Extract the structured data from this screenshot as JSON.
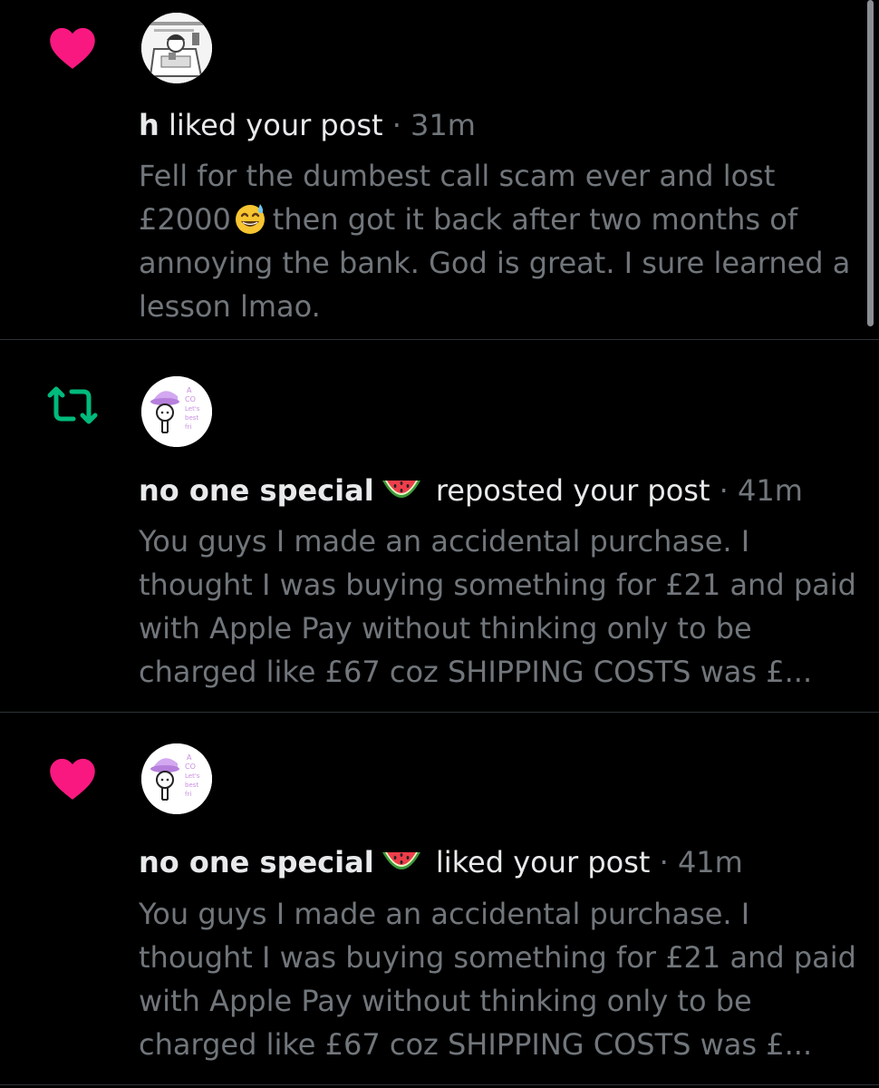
{
  "colors": {
    "like": "#f91880",
    "repost": "#00ba7c",
    "muted": "#71767b",
    "text": "#e7e9ea",
    "divider": "#2f3336"
  },
  "notifications": [
    {
      "type": "like",
      "icon": "heart-icon",
      "name": "h",
      "name_emoji": "",
      "action": "liked your post",
      "separator": "·",
      "time": "31m",
      "body_before_emoji": "Fell for the dumbest call scam ever and lost £2000",
      "body_emoji": "grinning-sweat-emoji",
      "body_after_emoji": "then got it back after two months of annoying the bank. God is great. I sure learned a lesson lmao."
    },
    {
      "type": "repost",
      "icon": "repost-icon",
      "name": "no one special",
      "name_emoji": "watermelon-emoji",
      "action": "reposted your post",
      "separator": "·",
      "time": "41m",
      "body": "You guys I made an accidental purchase. I thought I was buying something for £21 and paid with Apple Pay without thinking only to be charged like £67 coz SHIPPING COSTS was £..."
    },
    {
      "type": "like",
      "icon": "heart-icon",
      "name": "no one special",
      "name_emoji": "watermelon-emoji",
      "action": "liked your post",
      "separator": "·",
      "time": "41m",
      "body": "You guys I made an accidental purchase. I thought I was buying something for £21 and paid with Apple Pay without thinking only to be charged like £67 coz SHIPPING COSTS was £..."
    }
  ]
}
